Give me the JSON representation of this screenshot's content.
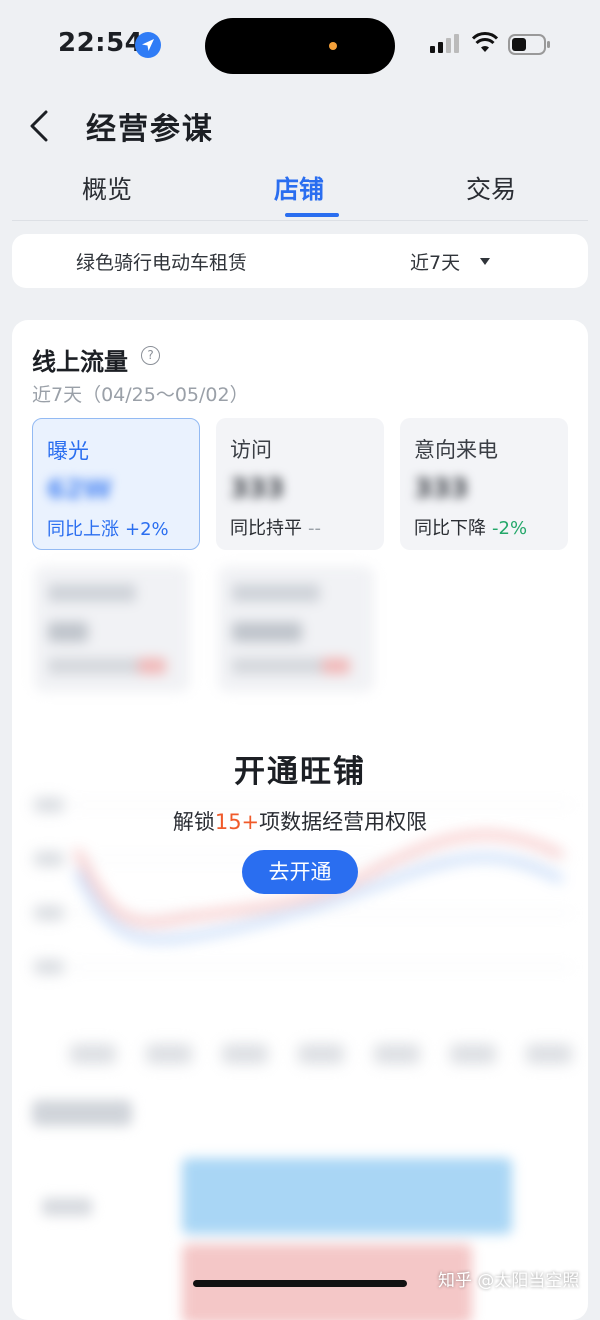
{
  "status_bar": {
    "time": "22:54"
  },
  "nav": {
    "title": "经营参谋"
  },
  "tabs": [
    {
      "label": "概览",
      "active": false
    },
    {
      "label": "店铺",
      "active": true
    },
    {
      "label": "交易",
      "active": false
    }
  ],
  "filter": {
    "store_name": "绿色骑行电动车租赁",
    "period": "近7天"
  },
  "traffic": {
    "title": "线上流量",
    "range": "近7天（04/25～05/02）",
    "metrics": [
      {
        "label": "曝光",
        "value": "62W",
        "compare": "同比上涨",
        "delta": "+2%",
        "selected": true
      },
      {
        "label": "访问",
        "value": "333",
        "compare": "同比持平",
        "delta": "--",
        "selected": false
      },
      {
        "label": "意向来电",
        "value": "333",
        "compare": "同比下降",
        "delta": "-2%",
        "selected": false
      }
    ]
  },
  "upgrade": {
    "title": "开通旺铺",
    "desc_prefix": "解锁",
    "desc_highlight": "15+",
    "desc_suffix": "项数据经营用权限",
    "button": "去开通"
  },
  "watermark": "知乎 @太阳当空照",
  "colors": {
    "accent": "#2a6ef0",
    "highlight": "#f05a2a",
    "down": "#23a769"
  }
}
